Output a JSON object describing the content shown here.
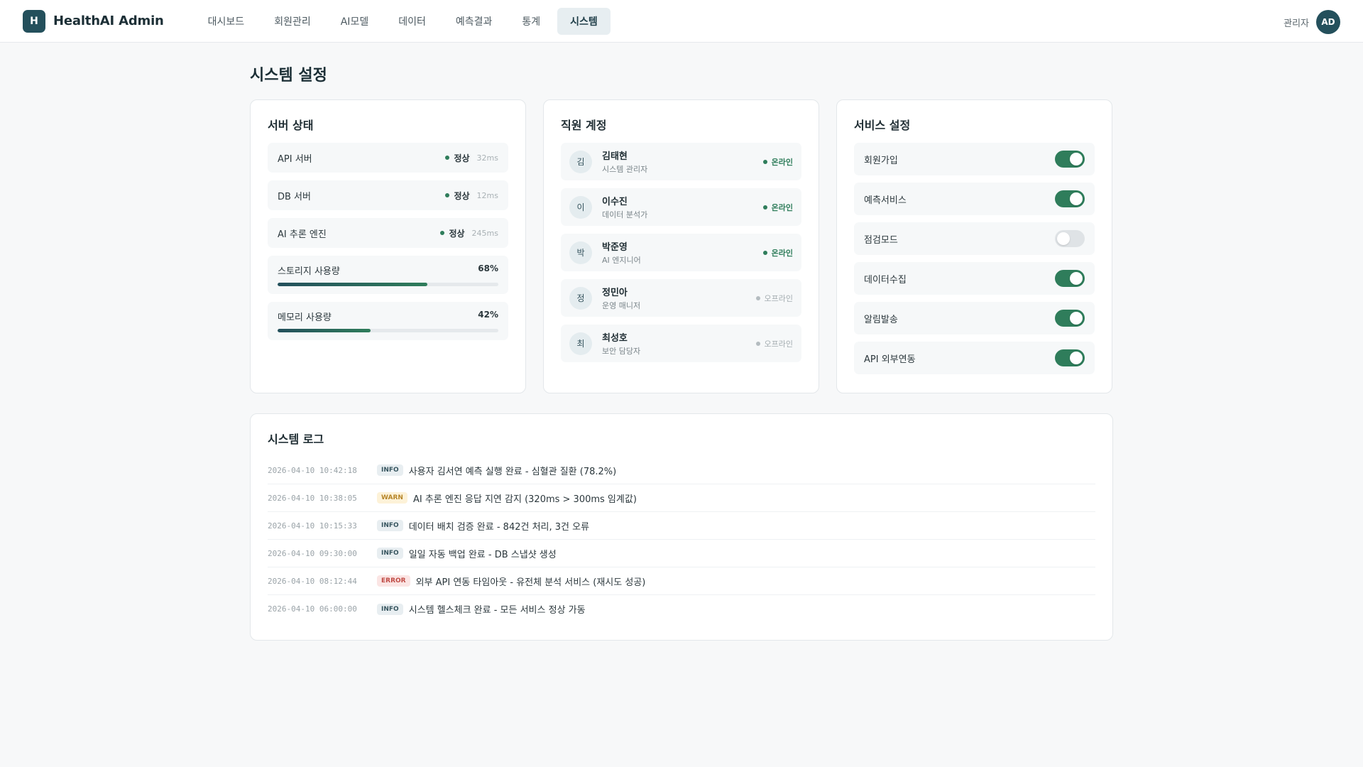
{
  "app": {
    "logo_letter": "H",
    "name": "HealthAI Admin"
  },
  "nav": {
    "items": [
      "대시보드",
      "회원관리",
      "AI모델",
      "데이터",
      "예측결과",
      "통계",
      "시스템"
    ],
    "active_index": 6
  },
  "user": {
    "label": "관리자",
    "initials": "AD"
  },
  "page": {
    "title": "시스템 설정"
  },
  "server_status": {
    "title": "서버 상태",
    "servers": [
      {
        "name": "API 서버",
        "status": "정상",
        "latency": "32ms"
      },
      {
        "name": "DB 서버",
        "status": "정상",
        "latency": "12ms"
      },
      {
        "name": "AI 추론 엔진",
        "status": "정상",
        "latency": "245ms"
      }
    ],
    "usage": [
      {
        "label": "스토리지 사용량",
        "value": "68%",
        "fraction": 0.68
      },
      {
        "label": "메모리 사용량",
        "value": "42%",
        "fraction": 0.42
      }
    ]
  },
  "staff": {
    "title": "직원 계정",
    "members": [
      {
        "initial": "김",
        "name": "김태현",
        "role": "시스템 관리자",
        "status": "온라인",
        "online": true
      },
      {
        "initial": "이",
        "name": "이수진",
        "role": "데이터 분석가",
        "status": "온라인",
        "online": true
      },
      {
        "initial": "박",
        "name": "박준영",
        "role": "AI 엔지니어",
        "status": "온라인",
        "online": true
      },
      {
        "initial": "정",
        "name": "정민아",
        "role": "운영 매니저",
        "status": "오프라인",
        "online": false
      },
      {
        "initial": "최",
        "name": "최성호",
        "role": "보안 담당자",
        "status": "오프라인",
        "online": false
      }
    ]
  },
  "services": {
    "title": "서비스 설정",
    "items": [
      {
        "name": "회원가입",
        "enabled": true
      },
      {
        "name": "예측서비스",
        "enabled": true
      },
      {
        "name": "점검모드",
        "enabled": false
      },
      {
        "name": "데이터수집",
        "enabled": true
      },
      {
        "name": "알림발송",
        "enabled": true
      },
      {
        "name": "API 외부연동",
        "enabled": true
      }
    ]
  },
  "logs": {
    "title": "시스템 로그",
    "entries": [
      {
        "time": "2026-04-10 10:42:18",
        "level": "INFO",
        "message": "사용자 김서연 예측 실행 완료 - 심혈관 질환 (78.2%)"
      },
      {
        "time": "2026-04-10 10:38:05",
        "level": "WARN",
        "message": "AI 추론 엔진 응답 지연 감지 (320ms > 300ms 임계값)"
      },
      {
        "time": "2026-04-10 10:15:33",
        "level": "INFO",
        "message": "데이터 배치 검증 완료 - 842건 처리, 3건 오류"
      },
      {
        "time": "2026-04-10 09:30:00",
        "level": "INFO",
        "message": "일일 자동 백업 완료 - DB 스냅샷 생성"
      },
      {
        "time": "2026-04-10 08:12:44",
        "level": "ERROR",
        "message": "외부 API 연동 타임아웃 - 유전체 분석 서비스 (재시도 성공)"
      },
      {
        "time": "2026-04-10 06:00:00",
        "level": "INFO",
        "message": "시스템 헬스체크 완료 - 모든 서비스 정상 가동"
      }
    ]
  },
  "colors": {
    "brand": "#24505c",
    "accent": "#2f7d5b",
    "warn": "#b7862a",
    "error": "#c04b45"
  }
}
